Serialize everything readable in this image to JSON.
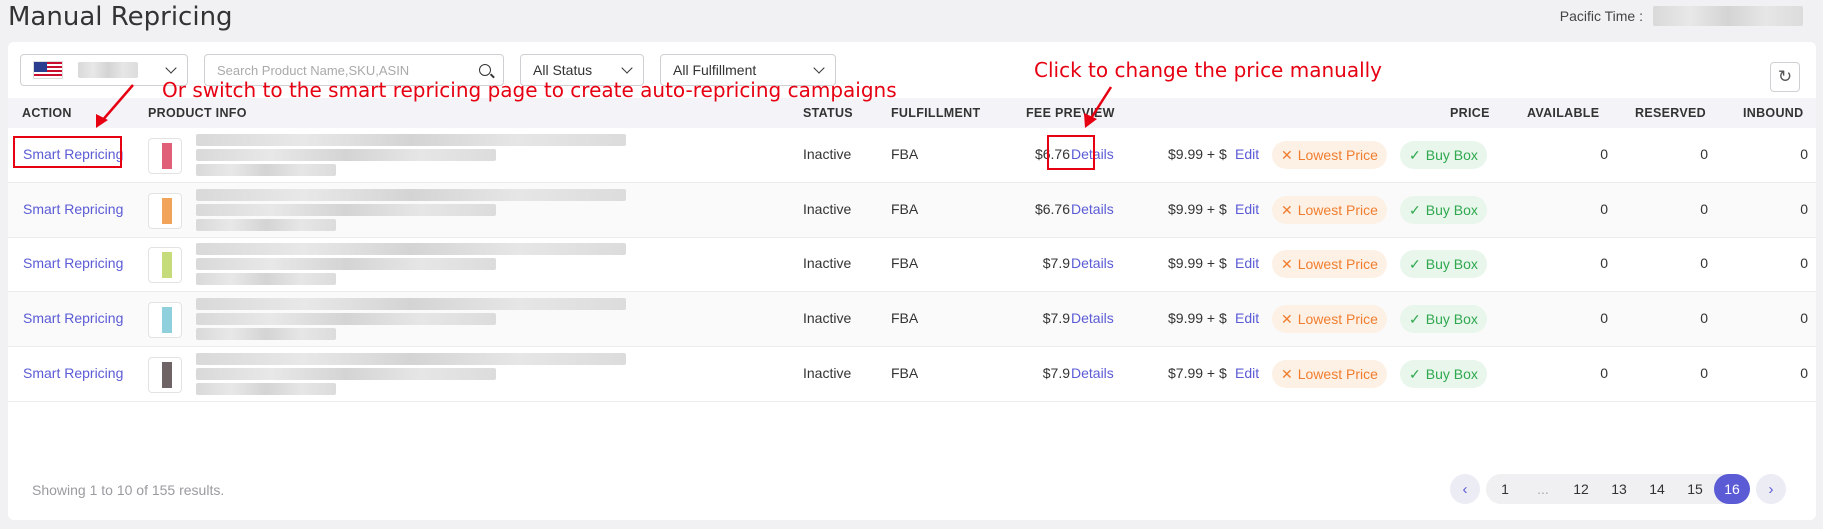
{
  "page": {
    "title": "Manual Repricing",
    "tz_label": "Pacific Time :"
  },
  "filters": {
    "search_placeholder": "Search Product Name,SKU,ASIN",
    "status": "All Status",
    "fulfillment": "All Fulfillment"
  },
  "table": {
    "headers": [
      "ACTION",
      "PRODUCT INFO",
      "STATUS",
      "FULFILLMENT",
      "FEE PREVIEW",
      "PRICE",
      "AVAILABLE",
      "RESERVED",
      "INBOUND"
    ],
    "rows": [
      {
        "action": "Smart Repricing",
        "status": "Inactive",
        "fulfillment": "FBA",
        "fee": "$6.76",
        "details": "Details",
        "price": "$9.99 + $",
        "edit": "Edit",
        "lowest": "Lowest Price",
        "buybox": "Buy Box",
        "available": "0",
        "reserved": "0",
        "inbound": "0",
        "thumb_color": "#e0607a"
      },
      {
        "action": "Smart Repricing",
        "status": "Inactive",
        "fulfillment": "FBA",
        "fee": "$6.76",
        "details": "Details",
        "price": "$9.99 + $",
        "edit": "Edit",
        "lowest": "Lowest Price",
        "buybox": "Buy Box",
        "available": "0",
        "reserved": "0",
        "inbound": "0",
        "thumb_color": "#f2a35a"
      },
      {
        "action": "Smart Repricing",
        "status": "Inactive",
        "fulfillment": "FBA",
        "fee": "$7.9",
        "details": "Details",
        "price": "$9.99 + $",
        "edit": "Edit",
        "lowest": "Lowest Price",
        "buybox": "Buy Box",
        "available": "0",
        "reserved": "0",
        "inbound": "0",
        "thumb_color": "#c6dc7a"
      },
      {
        "action": "Smart Repricing",
        "status": "Inactive",
        "fulfillment": "FBA",
        "fee": "$7.9",
        "details": "Details",
        "price": "$9.99 + $",
        "edit": "Edit",
        "lowest": "Lowest Price",
        "buybox": "Buy Box",
        "available": "0",
        "reserved": "0",
        "inbound": "0",
        "thumb_color": "#8fd0dc"
      },
      {
        "action": "Smart Repricing",
        "status": "Inactive",
        "fulfillment": "FBA",
        "fee": "$7.9",
        "details": "Details",
        "price": "$7.99 + $",
        "edit": "Edit",
        "lowest": "Lowest Price",
        "buybox": "Buy Box",
        "available": "0",
        "reserved": "0",
        "inbound": "0",
        "thumb_color": "#6e6466"
      }
    ]
  },
  "annotations": {
    "smart": "Or switch to the smart repricing page to create auto-repricing campaigns",
    "edit": "Click to change the price manually"
  },
  "footer": {
    "showing": "Showing 1 to 10 of 155 results.",
    "pages": [
      "1",
      "...",
      "12",
      "13",
      "14",
      "15",
      "16"
    ],
    "current_page": "16"
  },
  "colors": {
    "accent": "#5b5bd6",
    "annotation": "#e60012",
    "lowest": "#f07d2e",
    "buybox": "#2fa84f"
  }
}
